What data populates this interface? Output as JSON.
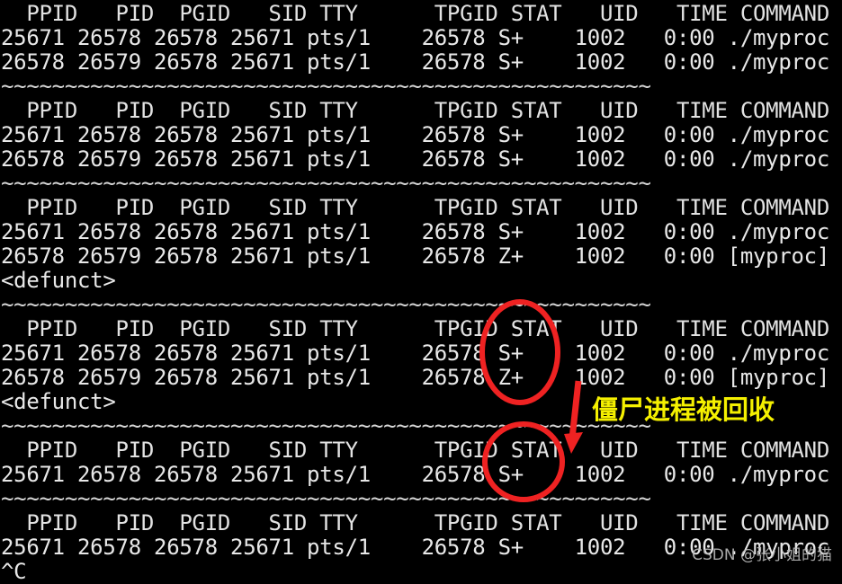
{
  "terminal": {
    "background_color": "#000000",
    "text_color": "#e8e8e8",
    "separator": "~~~~~~~~~~~~~~~~~~~~~~~~~~~~~~~~~~~~~~~~~~~~~~~~~~",
    "lines": [
      "  PPID   PID  PGID   SID TTY      TPGID STAT   UID   TIME COMMAND",
      "25671 26578 26578 25671 pts/1    26578 S+    1002   0:00 ./myproc",
      "26578 26579 26578 25671 pts/1    26578 S+    1002   0:00 ./myproc",
      "~~~~~~~~~~~~~~~~~~~~~~~~~~~~~~~~~~~~~~~~~~~~~~~~~~~",
      "  PPID   PID  PGID   SID TTY      TPGID STAT   UID   TIME COMMAND",
      "25671 26578 26578 25671 pts/1    26578 S+    1002   0:00 ./myproc",
      "26578 26579 26578 25671 pts/1    26578 S+    1002   0:00 ./myproc",
      "~~~~~~~~~~~~~~~~~~~~~~~~~~~~~~~~~~~~~~~~~~~~~~~~~~~",
      "  PPID   PID  PGID   SID TTY      TPGID STAT   UID   TIME COMMAND",
      "25671 26578 26578 25671 pts/1    26578 S+    1002   0:00 ./myproc",
      "26578 26579 26578 25671 pts/1    26578 Z+    1002   0:00 [myproc]",
      "<defunct>",
      "~~~~~~~~~~~~~~~~~~~~~~~~~~~~~~~~~~~~~~~~~~~~~~~~~~~",
      "  PPID   PID  PGID   SID TTY      TPGID STAT   UID   TIME COMMAND",
      "25671 26578 26578 25671 pts/1    26578 S+    1002   0:00 ./myproc",
      "26578 26579 26578 25671 pts/1    26578 Z+    1002   0:00 [myproc]",
      "<defunct>",
      "~~~~~~~~~~~~~~~~~~~~~~~~~~~~~~~~~~~~~~~~~~~~~~~~~~~",
      "  PPID   PID  PGID   SID TTY      TPGID STAT   UID   TIME COMMAND",
      "25671 26578 26578 25671 pts/1    26578 S+    1002   0:00 ./myproc",
      "~~~~~~~~~~~~~~~~~~~~~~~~~~~~~~~~~~~~~~~~~~~~~~~~~~~",
      "  PPID   PID  PGID   SID TTY      TPGID STAT   UID   TIME COMMAND",
      "25671 26578 26578 25671 pts/1    26578 S+    1002   0:00 ./myproc",
      "^C"
    ],
    "columns": [
      "PPID",
      "PID",
      "PGID",
      "SID",
      "TTY",
      "TPGID",
      "STAT",
      "UID",
      "TIME",
      "COMMAND"
    ],
    "interrupt_line": "^C"
  },
  "annotations": {
    "color": "#ef2222",
    "note_color": "#f5f000",
    "note_text": "僵尸进程被回收",
    "ellipse_1_label": "stat-column-zombie-highlight",
    "ellipse_2_label": "stat-column-reaped-highlight",
    "arrow_label": "downward-arrow"
  },
  "watermark": {
    "text": "CSDN @张小姐的猫",
    "color": "#b9b9b9"
  }
}
